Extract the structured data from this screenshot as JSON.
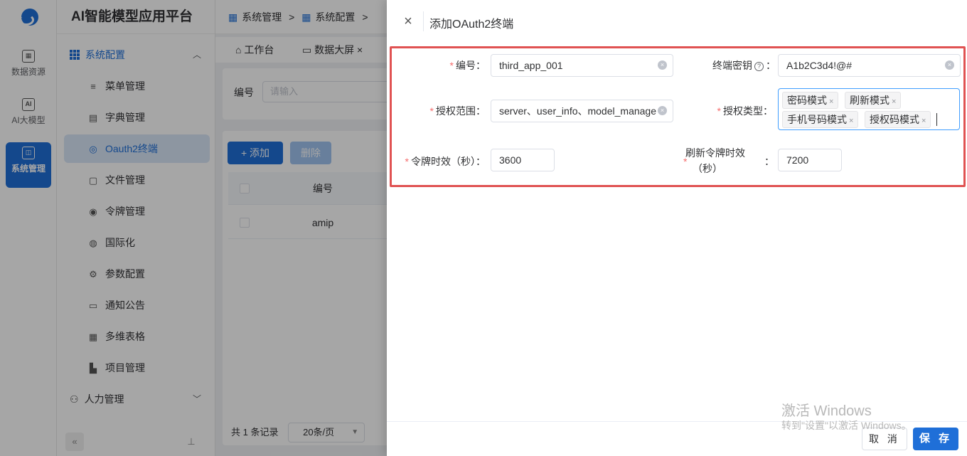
{
  "app": {
    "brand": "AI智能模型应用平台"
  },
  "rail": {
    "items": [
      {
        "label": "数据资源",
        "icon": "▦"
      },
      {
        "label": "AI大模型",
        "icon": "AI"
      },
      {
        "label": "系统管理",
        "icon": "◫"
      }
    ]
  },
  "menu": {
    "group": "系统配置",
    "group_arrow": "︿",
    "items": [
      {
        "label": "菜单管理",
        "icon": "≡"
      },
      {
        "label": "字典管理",
        "icon": "▤"
      },
      {
        "label": "Oauth2终端",
        "icon": "◎"
      },
      {
        "label": "文件管理",
        "icon": "▢"
      },
      {
        "label": "令牌管理",
        "icon": "◉"
      },
      {
        "label": "国际化",
        "icon": "◍"
      },
      {
        "label": "参数配置",
        "icon": "⚙"
      },
      {
        "label": "通知公告",
        "icon": "▭"
      },
      {
        "label": "多维表格",
        "icon": "▦"
      },
      {
        "label": "项目管理",
        "icon": "▙"
      }
    ],
    "hr": "人力管理",
    "hr_arrow": "﹀",
    "collapse": "«",
    "pin": "⊥"
  },
  "crumbs": {
    "c1": "系统管理",
    "c2": "系统配置",
    "sep": ">"
  },
  "tabs": {
    "t1": "工作台",
    "t2": "数据大屏",
    "close": "×"
  },
  "query": {
    "label": "编号",
    "placeholder": "请输入"
  },
  "toolbar": {
    "add": "+ 添加",
    "delete": "删除"
  },
  "table": {
    "header": "编号",
    "rows": [
      "amip"
    ]
  },
  "pager": {
    "total": "共 1 条记录",
    "size": "20条/页",
    "caret": "▼"
  },
  "drawer": {
    "title": "添加OAuth2终端",
    "close": "×",
    "fields": {
      "code_label": "编号：",
      "code_value": "third_app_001",
      "secret_label": "终端密钥",
      "secret_colon": "：",
      "secret_value": "A1b2C3d4!@#",
      "scope_label": "授权范围：",
      "scope_value": "server、user_info、model_manage",
      "grant_label": "授权类型：",
      "grant_tags": [
        "密码模式",
        "刷新模式",
        "手机号码模式",
        "授权码模式"
      ],
      "token_label": "令牌时效（秒）：",
      "token_value": "3600",
      "refresh_label_1": "刷新令牌时效",
      "refresh_label_2": "（秒）",
      "refresh_colon": "：",
      "refresh_value": "7200"
    },
    "required_mark": "*",
    "clear_icon": "×",
    "help_icon": "?",
    "cancel": "取 消",
    "save": "保 存"
  },
  "watermark": {
    "line1": "激活 Windows",
    "line2": "转到\"设置\"以激活 Windows。"
  },
  "colors": {
    "primary": "#1f6fd8",
    "highlight_border": "#e05252",
    "required": "#f56c6c"
  }
}
